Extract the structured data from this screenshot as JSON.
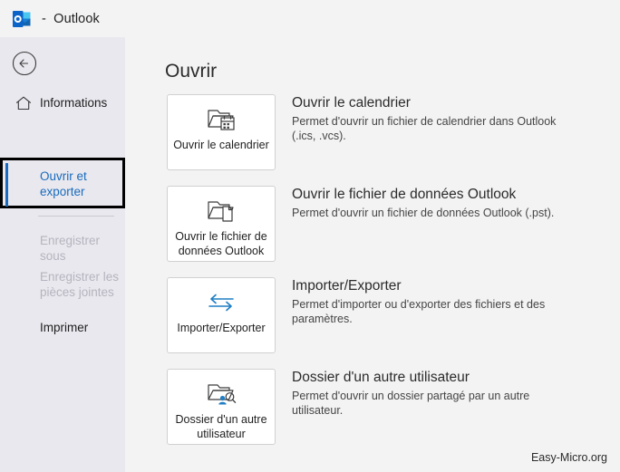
{
  "titlebar": {
    "logo_icon": "outlook-logo-icon",
    "title": "-  Outlook"
  },
  "sidebar": {
    "back_button_icon": "back-arrow-icon",
    "items": [
      {
        "label": "Informations",
        "icon": "home-icon",
        "state": "enabled"
      },
      {
        "label": "Ouvrir et exporter",
        "icon": "none",
        "state": "selected"
      },
      {
        "label": "Enregistrer sous",
        "icon": "none",
        "state": "disabled"
      },
      {
        "label": "Enregistrer les pièces jointes",
        "icon": "none",
        "state": "disabled"
      },
      {
        "label": "Imprimer",
        "icon": "none",
        "state": "enabled"
      }
    ]
  },
  "main": {
    "page_title": "Ouvrir",
    "options": [
      {
        "card_label": "Ouvrir le calendrier",
        "icon": "folder-calendar-icon",
        "heading": "Ouvrir le calendrier",
        "description": "Permet d'ouvrir un fichier de calendrier dans Outlook (.ics, .vcs)."
      },
      {
        "card_label": "Ouvrir le fichier de données Outlook",
        "icon": "folder-file-icon",
        "heading": "Ouvrir le fichier de données Outlook",
        "description": "Permet d'ouvrir un fichier de données Outlook (.pst)."
      },
      {
        "card_label": "Importer/Exporter",
        "icon": "import-export-arrows-icon",
        "heading": "Importer/Exporter",
        "description": "Permet d'importer ou d'exporter des fichiers et des paramètres."
      },
      {
        "card_label": "Dossier d'un autre utilisateur",
        "icon": "folder-user-search-icon",
        "heading": "Dossier d'un autre utilisateur",
        "description": "Permet d'ouvrir un dossier partagé par un autre utilisateur."
      }
    ]
  },
  "watermark": {
    "text": "Easy-Micro.org"
  },
  "colors": {
    "accent_blue": "#1a6bbd",
    "icon_blue": "#1f7ec4",
    "sidebar_bg": "#e8e8ee",
    "main_bg": "#f3f3f3",
    "annotation": "#000000"
  }
}
